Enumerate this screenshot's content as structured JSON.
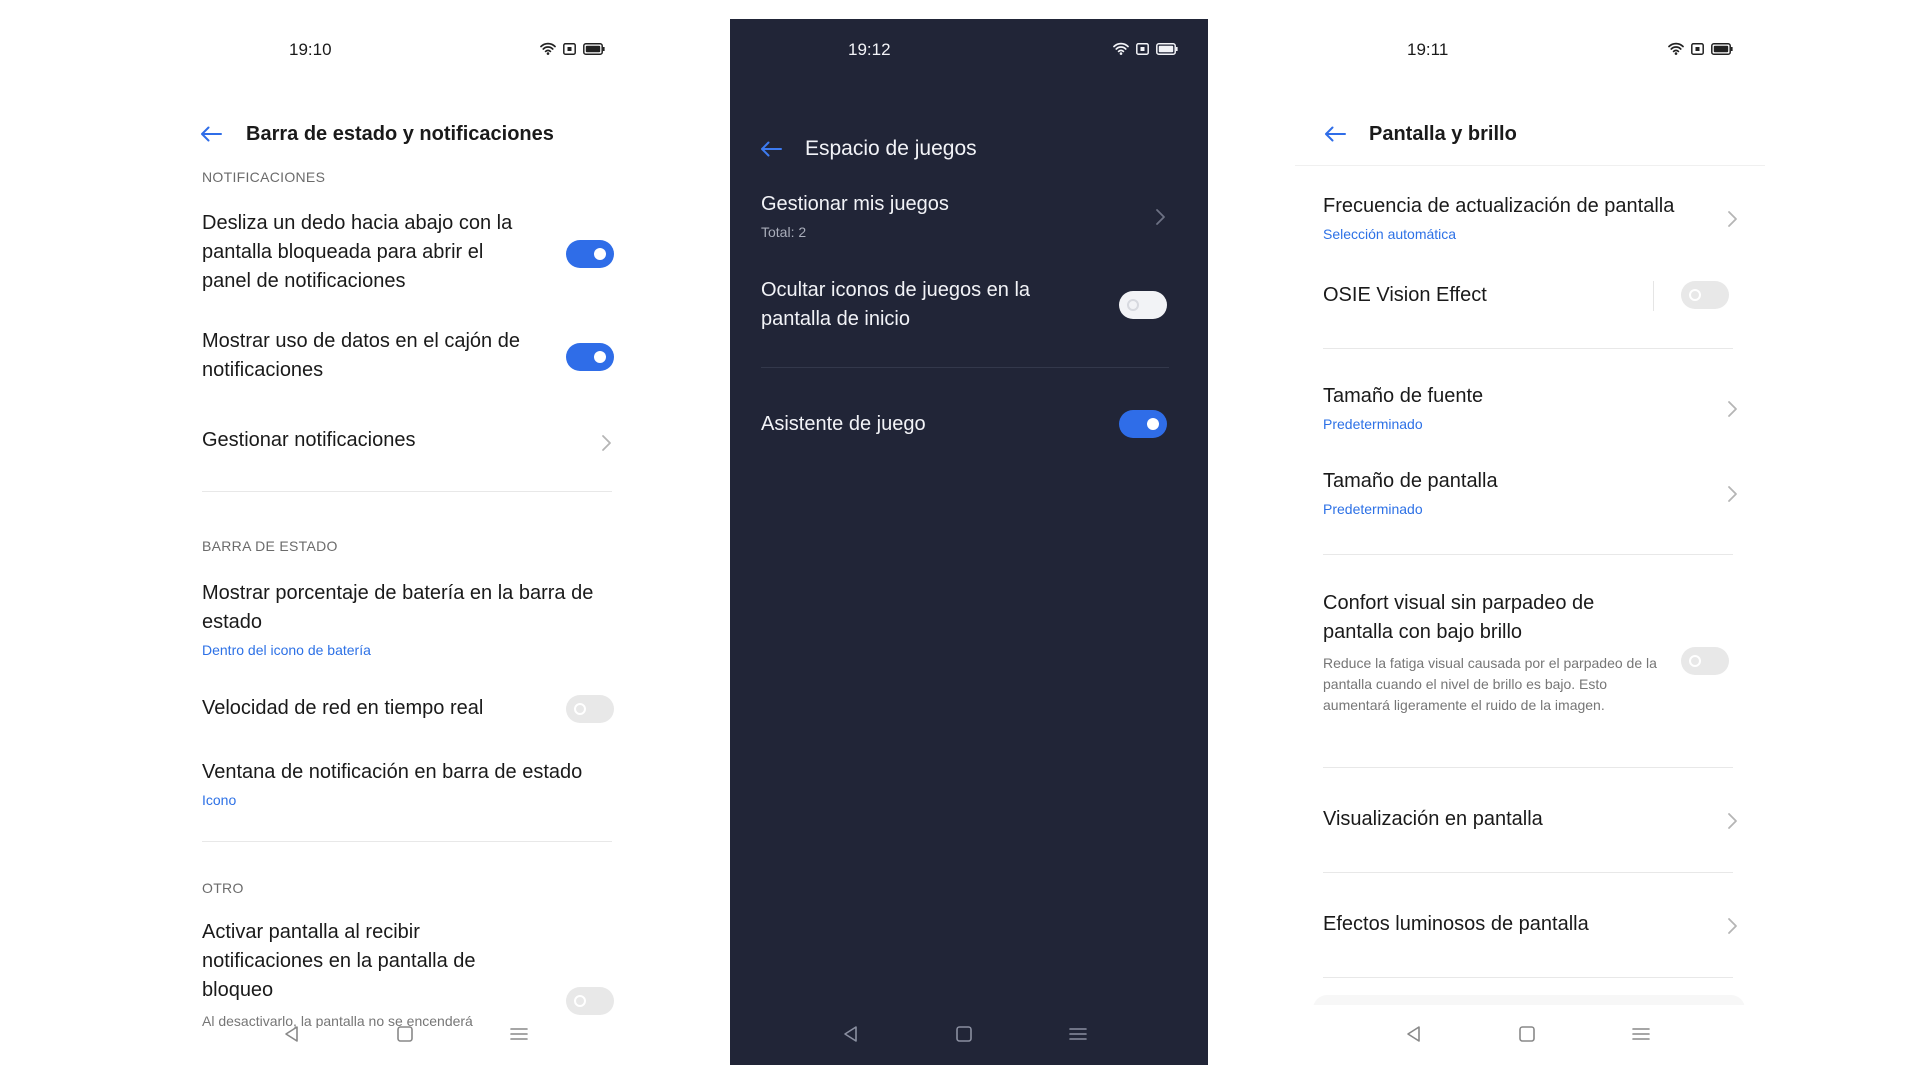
{
  "screens": [
    {
      "time": "19:10",
      "title": "Barra de estado y notificaciones",
      "sections": {
        "notificaciones": "NOTIFICACIONES",
        "barra": "BARRA DE ESTADO",
        "otro": "OTRO"
      },
      "rows": {
        "swipe": "Desliza un dedo hacia abajo con la pantalla bloqueada para abrir el panel de notificaciones",
        "data_usage": "Mostrar uso de datos en el cajón de notificaciones",
        "manage": "Gestionar notificaciones",
        "battery": "Mostrar porcentaje de batería en la barra de estado",
        "battery_sub": "Dentro del icono de batería",
        "netspeed": "Velocidad de red en tiempo real",
        "notif_window": "Ventana de notificación en barra de estado",
        "notif_window_sub": "Icono",
        "wake": "Activar pantalla al recibir notificaciones en la pantalla de bloqueo",
        "wake_desc": "Al desactivarlo, la pantalla no se encenderá"
      },
      "toggles": {
        "swipe": true,
        "data_usage": true,
        "netspeed": false,
        "wake": false
      }
    },
    {
      "time": "19:12",
      "title": "Espacio de juegos",
      "rows": {
        "manage_games": "Gestionar mis juegos",
        "manage_games_sub": "Total: 2",
        "hide_icons": "Ocultar iconos de juegos en la pantalla de inicio",
        "assistant": "Asistente de juego"
      },
      "toggles": {
        "hide_icons": false,
        "assistant": true
      }
    },
    {
      "time": "19:11",
      "title": "Pantalla y brillo",
      "rows": {
        "refresh": "Frecuencia de actualización de pantalla",
        "refresh_sub": "Selección automática",
        "osie": "OSIE Vision Effect",
        "font_size": "Tamaño de fuente",
        "font_size_sub": "Predeterminado",
        "screen_size": "Tamaño de pantalla",
        "screen_size_sub": "Predeterminado",
        "comfort": "Confort visual sin parpadeo de pantalla con bajo brillo",
        "comfort_desc": "Reduce la fatiga visual causada por el parpadeo de la pantalla cuando el nivel de brillo es bajo. Esto aumentará ligeramente el ruido de la imagen.",
        "aod": "Visualización en pantalla",
        "effects": "Efectos luminosos de pantalla"
      },
      "toggles": {
        "osie": false,
        "comfort": false
      }
    }
  ],
  "colors": {
    "accent": "#2f6de8",
    "dark_bg": "#212537",
    "link": "#2d71e6"
  },
  "icons": [
    "wifi-icon",
    "nfc-icon",
    "battery-icon",
    "back-arrow-icon",
    "chevron-right-icon",
    "nav-back-icon",
    "nav-home-icon",
    "nav-recents-icon"
  ]
}
